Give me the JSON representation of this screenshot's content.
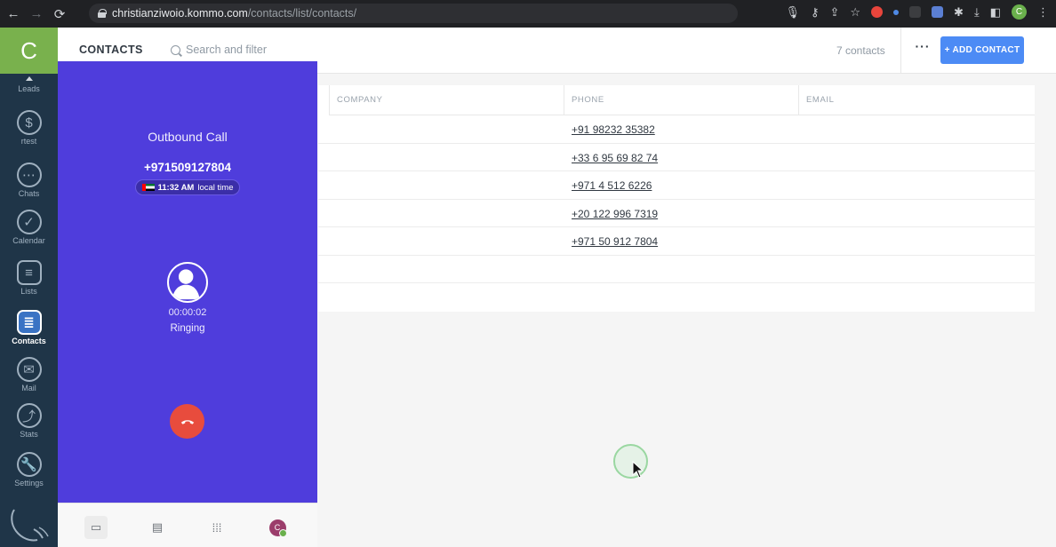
{
  "browser": {
    "url_host": "christianziwoio.kommo.com",
    "url_path": "/contacts/list/contacts/",
    "profile_initial": "C"
  },
  "sidebar": {
    "logo": "C",
    "items": [
      {
        "label": "Leads",
        "icon": "leads-arrow-icon"
      },
      {
        "label": "rtest",
        "icon": "dollar-icon"
      },
      {
        "label": "Chats",
        "icon": "chat-icon"
      },
      {
        "label": "Calendar",
        "icon": "check-icon"
      },
      {
        "label": "Lists",
        "icon": "list-icon"
      },
      {
        "label": "Contacts",
        "icon": "contacts-icon",
        "active": true
      },
      {
        "label": "Mail",
        "icon": "mail-icon"
      },
      {
        "label": "Stats",
        "icon": "stats-icon"
      },
      {
        "label": "Settings",
        "icon": "wrench-icon"
      }
    ]
  },
  "header": {
    "title": "CONTACTS",
    "search_placeholder": "Search and filter",
    "count": "7 contacts",
    "more_label": "···",
    "add_label": "+ ADD CONTACT"
  },
  "table": {
    "columns": [
      "COMPANY",
      "PHONE",
      "EMAIL"
    ],
    "rows": [
      {
        "company": "",
        "phone": "+91 98232 35382",
        "email": ""
      },
      {
        "company": "",
        "phone": "+33 6 95 69 82 74",
        "email": ""
      },
      {
        "company": "",
        "phone": "+971 4 512 6226",
        "email": ""
      },
      {
        "company": "",
        "phone": "+20 122 996 7319",
        "email": ""
      },
      {
        "company": "",
        "phone": "+971 50 912 7804",
        "email": ""
      },
      {
        "company": "",
        "phone": "",
        "email": ""
      },
      {
        "company": "",
        "phone": "",
        "email": ""
      }
    ]
  },
  "call": {
    "title": "Outbound Call",
    "number": "+971509127804",
    "local_time": "11:32 AM",
    "local_time_suffix": "local time",
    "timer": "00:00:02",
    "status": "Ringing",
    "footer_avatar": "C"
  },
  "colors": {
    "call_panel": "#4f3ddc",
    "hangup": "#e84c3d",
    "add_button": "#4c8bf5",
    "sidebar": "#1f3548",
    "logo": "#79b14d"
  }
}
